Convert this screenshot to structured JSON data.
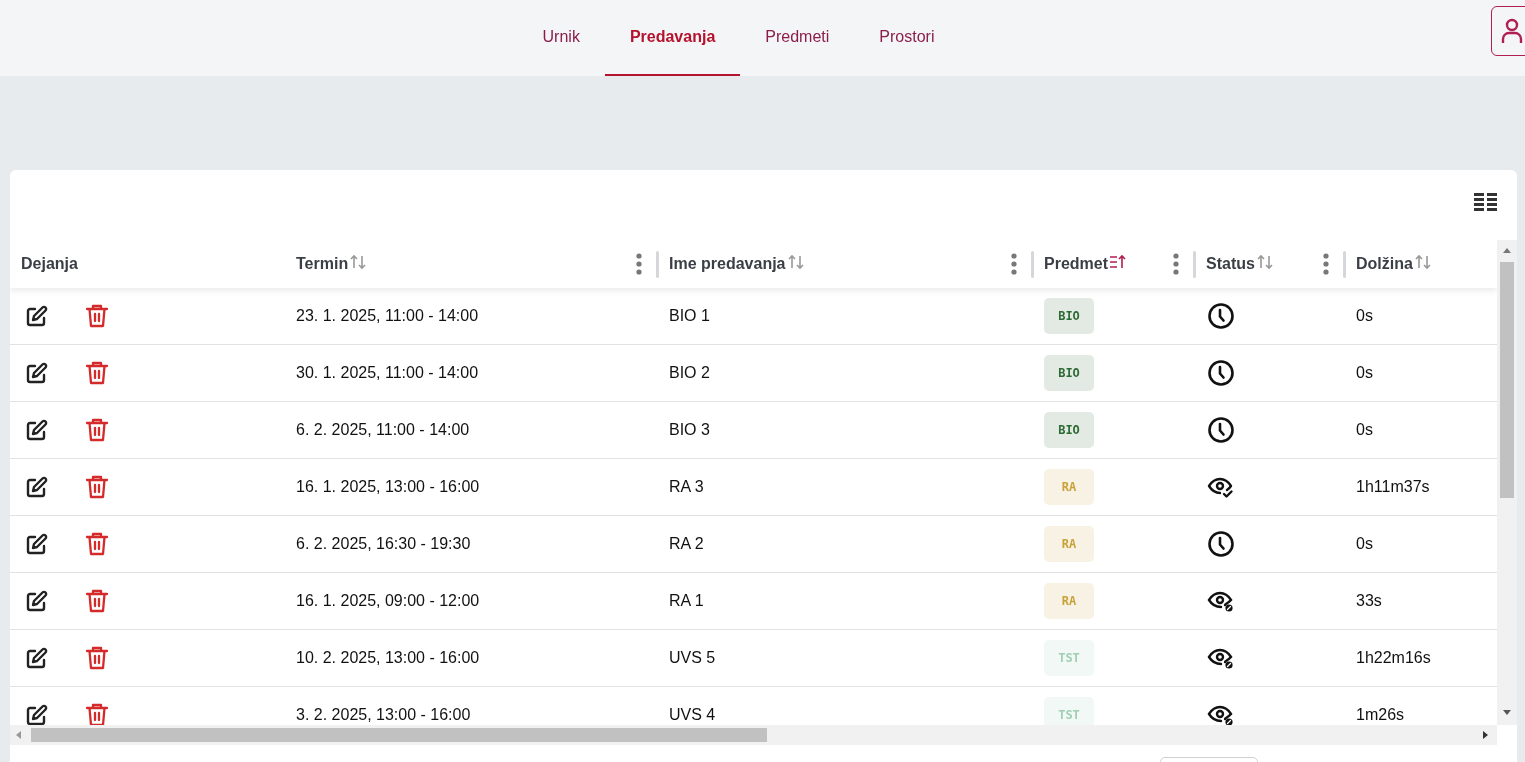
{
  "nav": {
    "tabs": [
      {
        "label": "Urnik",
        "selected": false
      },
      {
        "label": "Predavanja",
        "selected": true
      },
      {
        "label": "Predmeti",
        "selected": false
      },
      {
        "label": "Prostori",
        "selected": false
      }
    ]
  },
  "table": {
    "columns": [
      {
        "label": "Dejanja",
        "menu": false
      },
      {
        "label": "Termin",
        "sorted": false,
        "menu": true
      },
      {
        "label": "Ime predavanja",
        "sorted": false,
        "menu": true
      },
      {
        "label": "Predmet",
        "sorted": true,
        "menu": true
      },
      {
        "label": "Status",
        "sorted": false,
        "menu": true
      },
      {
        "label": "Dolžina",
        "sorted": false,
        "menu": false
      }
    ],
    "rows": [
      {
        "termin": "23. 1. 2025, 11:00 - 14:00",
        "ime": "BIO 1",
        "predmet": {
          "label": "BIO",
          "color": "#2e6b34"
        },
        "status": {
          "kind": "scheduled"
        },
        "dolzina": "0s"
      },
      {
        "termin": "30. 1. 2025, 11:00 - 14:00",
        "ime": "BIO 2",
        "predmet": {
          "label": "BIO",
          "color": "#2e6b34"
        },
        "status": {
          "kind": "scheduled"
        },
        "dolzina": "0s"
      },
      {
        "termin": "6. 2. 2025, 11:00 - 14:00",
        "ime": "BIO 3",
        "predmet": {
          "label": "BIO",
          "color": "#2e6b34"
        },
        "status": {
          "kind": "scheduled"
        },
        "dolzina": "0s"
      },
      {
        "termin": "16. 1. 2025, 13:00 - 16:00",
        "ime": "RA 3",
        "predmet": {
          "label": "RA",
          "color": "#c9a23a"
        },
        "status": {
          "kind": "watched"
        },
        "dolzina": "1h11m37s"
      },
      {
        "termin": "6. 2. 2025, 16:30 - 19:30",
        "ime": "RA 2",
        "predmet": {
          "label": "RA",
          "color": "#c9a23a"
        },
        "status": {
          "kind": "scheduled"
        },
        "dolzina": "0s"
      },
      {
        "termin": "16. 1. 2025, 09:00 - 12:00",
        "ime": "RA 1",
        "predmet": {
          "label": "RA",
          "color": "#c9a23a"
        },
        "status": {
          "kind": "unwatched"
        },
        "dolzina": "33s"
      },
      {
        "termin": "10. 2. 2025, 13:00 - 16:00",
        "ime": "UVS 5",
        "predmet": {
          "label": "TST",
          "color": "#9fcfb4"
        },
        "status": {
          "kind": "unwatched"
        },
        "dolzina": "1h22m16s"
      },
      {
        "termin": "3. 2. 2025, 13:00 - 16:00",
        "ime": "UVS 4",
        "predmet": {
          "label": "TST",
          "color": "#9fcfb4"
        },
        "status": {
          "kind": "unwatched"
        },
        "dolzina": "1m26s"
      }
    ]
  }
}
